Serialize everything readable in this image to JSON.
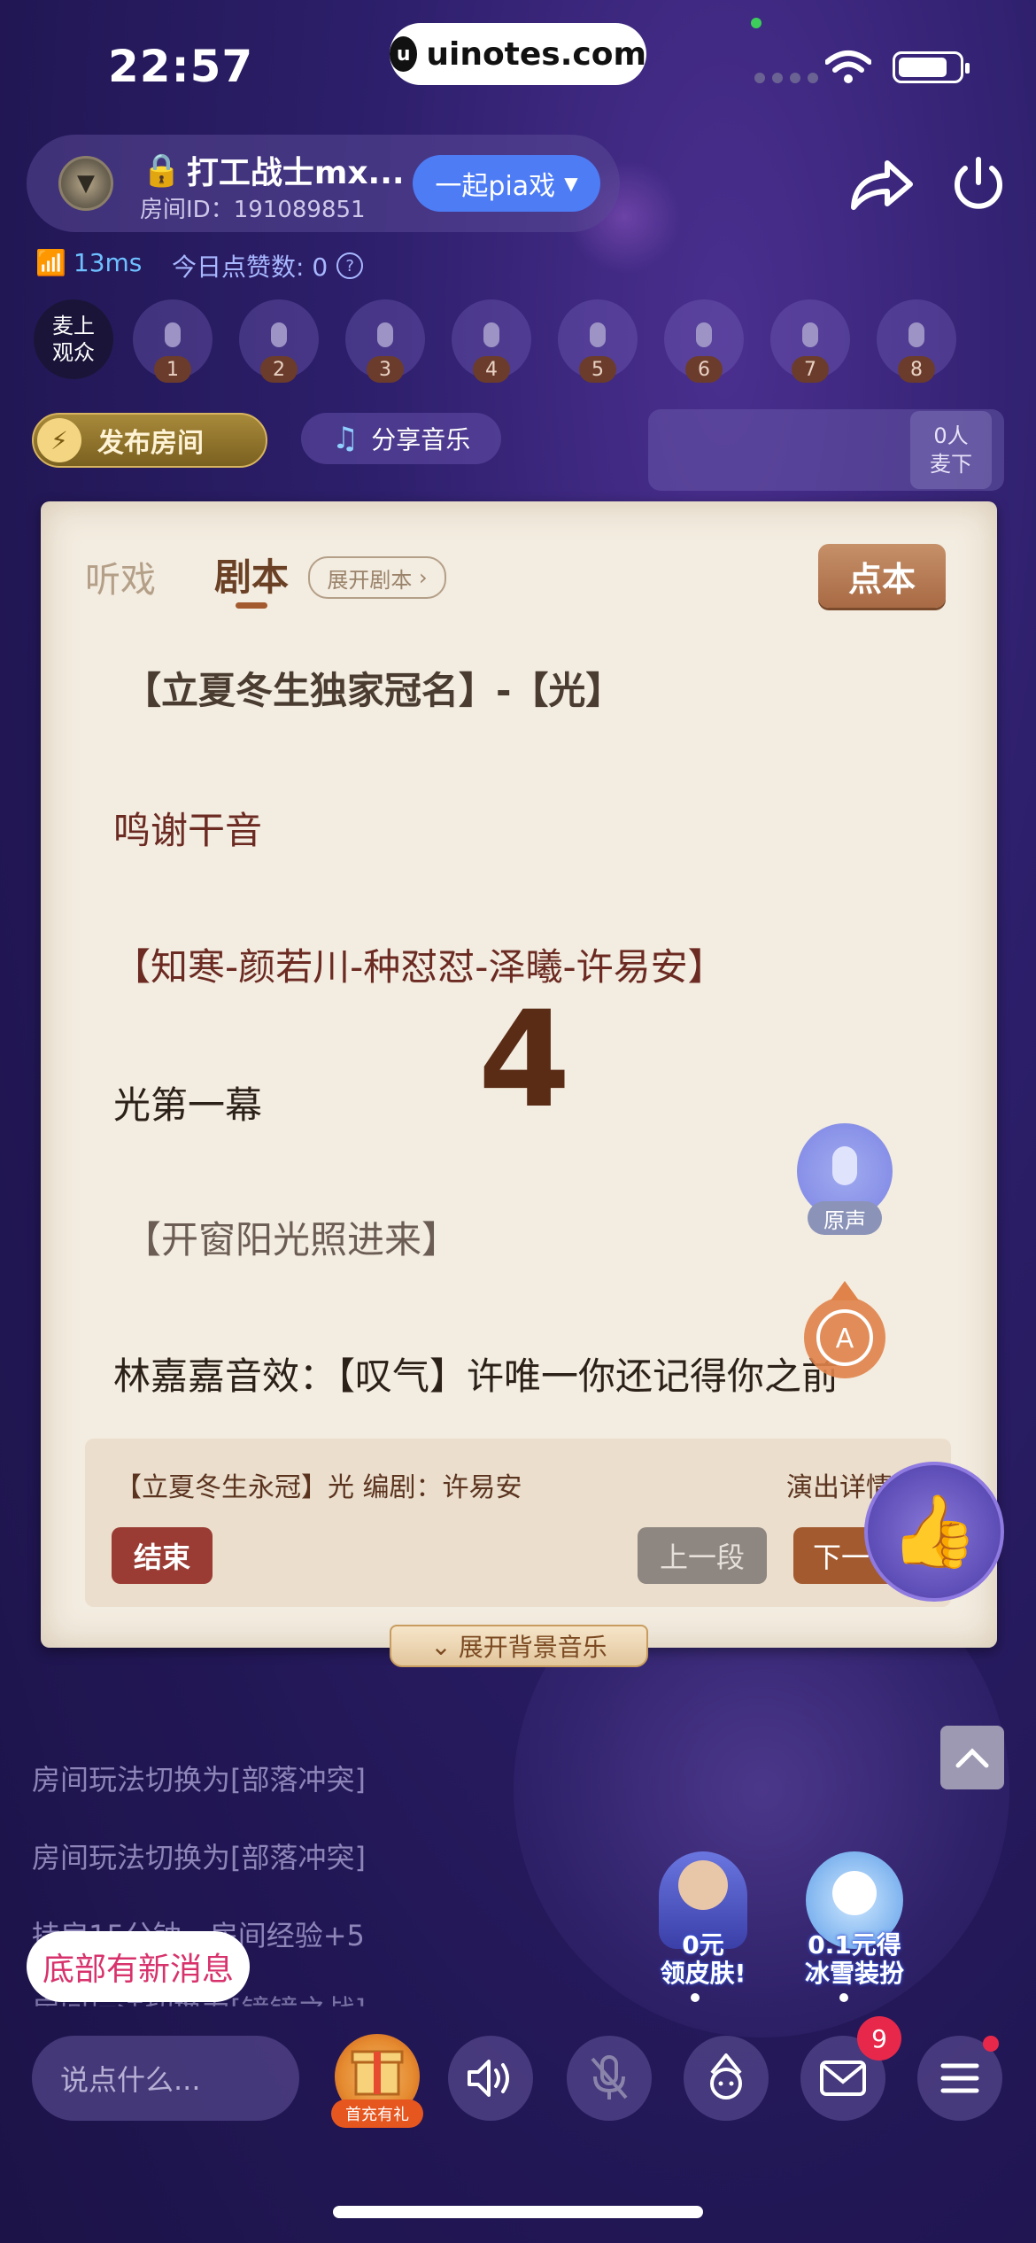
{
  "status_bar": {
    "time": "22:57",
    "url": "uinotes.com"
  },
  "room": {
    "name": "打工战士mx...",
    "id_label": "房间ID：191089851",
    "mode_button": "一起pia戏",
    "ping": "13ms",
    "likes_label": "今日点赞数: 0"
  },
  "seats": {
    "audience_label_1": "麦上",
    "audience_label_2": "观众",
    "numbers": [
      "1",
      "2",
      "3",
      "4",
      "5",
      "6",
      "7",
      "8"
    ]
  },
  "actions": {
    "publish": "发布房间",
    "share_music": "分享音乐",
    "offmic_count": "0人",
    "offmic_label": "麦下"
  },
  "script_card": {
    "tab_listen": "听戏",
    "tab_script": "剧本",
    "expand_script": "展开剧本",
    "pick_button": "点本",
    "lines": [
      "【立夏冬生独家冠名】-【光】",
      "鸣谢干音",
      "【知寒-颜若川-种怼怼-泽曦-许易安】",
      "光第一幕",
      "【开窗阳光照进来】",
      "林嘉嘉音效：【叹气】许唯一你还记得你之前"
    ],
    "countdown": "4",
    "voice_label": "原声",
    "auto_label": "A",
    "play_info": "【立夏冬生永冠】光  编剧：许易安",
    "perf_detail": "演出详情",
    "end_button": "结束",
    "prev_button": "上一段",
    "next_button": "下一",
    "bgm_tab": "展开背景音乐"
  },
  "chat": {
    "messages": [
      "房间玩法切换为[部落冲突]",
      "房间玩法切换为[部落冲突]",
      "持房15分钟，房间经验+5",
      "房间玩法切换为[镜镜之战]"
    ],
    "new_message_btn": "底部有新消息"
  },
  "promos": [
    {
      "line1": "0元",
      "line2": "领皮肤!"
    },
    {
      "line1": "0.1元得",
      "line2": "冰雪装扮"
    }
  ],
  "bottom_bar": {
    "input_placeholder": "说点什么...",
    "gift_label": "首充有礼",
    "mail_badge": "9"
  },
  "colors": {
    "accent_blue": "#4d7cf5",
    "card_bg": "#f3ece0",
    "badge_red": "#e8284a"
  }
}
